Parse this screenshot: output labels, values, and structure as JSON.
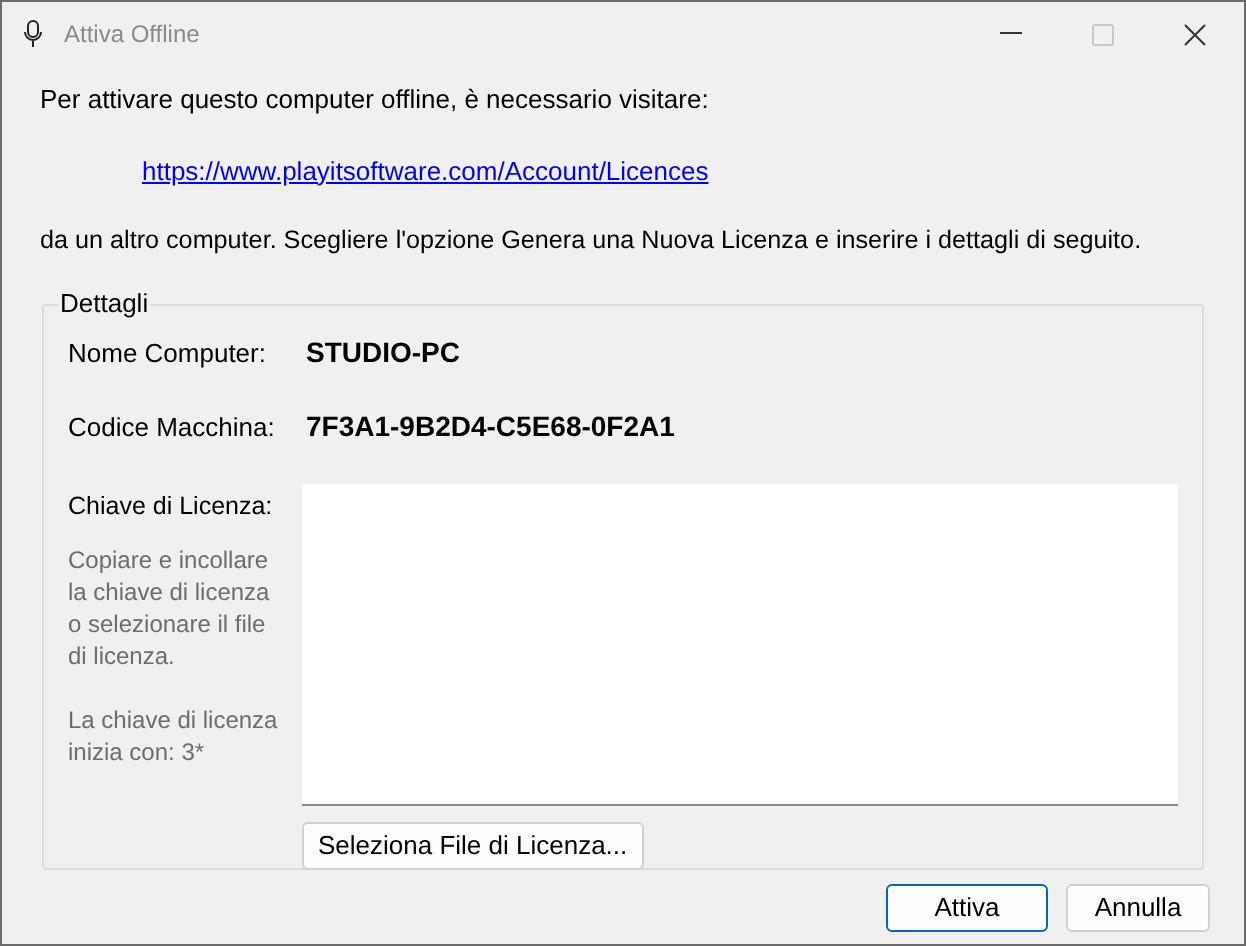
{
  "window": {
    "title": "Attiva Offline"
  },
  "title_buttons": [
    {
      "kind": "minimize",
      "disabled": false
    },
    {
      "kind": "maximize",
      "disabled": true
    },
    {
      "kind": "close",
      "disabled": false
    }
  ],
  "intro": "Per attivare questo computer offline, è necessario visitare:",
  "link": "https://www.playitsoftware.com/Account/Licences",
  "instructions": "da un altro computer. Scegliere l'opzione Genera una Nuova Licenza e inserire i dettagli di seguito.",
  "details": {
    "title": "Dettagli",
    "fields": [
      {
        "label": "Nome Computer:",
        "value": "STUDIO-PC"
      },
      {
        "label": "Codice Macchina:",
        "value": "7F3A1-9B2D4-C5E68-0F2A1"
      }
    ],
    "license_label": "Chiave di Licenza:",
    "help": [
      "Copiare e incollare la chiave di licenza o selezionare il file di licenza.",
      "La chiave di licenza inizia con: 3*"
    ],
    "select_file_button": "Seleziona File di Licenza..."
  },
  "buttons": [
    {
      "label": "Attiva",
      "default": true
    },
    {
      "label": "Annulla",
      "default": false
    }
  ]
}
